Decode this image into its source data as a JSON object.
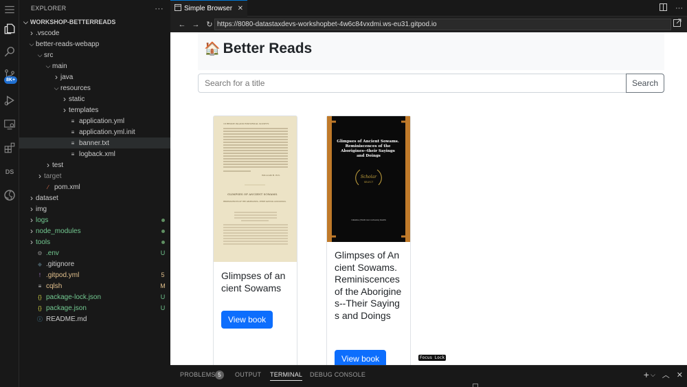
{
  "activity_bar": {
    "items": [
      "menu-icon",
      "explorer-icon",
      "search-icon",
      "source-control-icon",
      "run-debug-icon",
      "remote-explorer-icon",
      "extensions-icon",
      "datastax-icon",
      "github-icon"
    ],
    "source_control_badge": "8K+",
    "ds_label": "DS"
  },
  "sidebar": {
    "title": "EXPLORER",
    "more": "···",
    "root": "WORKSHOP-BETTERREADS",
    "tree": [
      {
        "label": ".vscode",
        "depth": 1,
        "kind": "folder-closed",
        "color": "#cccccc"
      },
      {
        "label": "better-reads-webapp",
        "depth": 1,
        "kind": "folder-open",
        "color": "#cccccc"
      },
      {
        "label": "src",
        "depth": 2,
        "kind": "folder-open",
        "color": "#cccccc"
      },
      {
        "label": "main",
        "depth": 3,
        "kind": "folder-open",
        "color": "#cccccc"
      },
      {
        "label": "java",
        "depth": 4,
        "kind": "folder-closed",
        "color": "#cccccc"
      },
      {
        "label": "resources",
        "depth": 4,
        "kind": "folder-open",
        "color": "#cccccc"
      },
      {
        "label": "static",
        "depth": 5,
        "kind": "folder-closed",
        "color": "#cccccc"
      },
      {
        "label": "templates",
        "depth": 5,
        "kind": "folder-closed",
        "color": "#cccccc"
      },
      {
        "label": "application.yml",
        "depth": 5,
        "kind": "file",
        "icon": "≡",
        "icon_color": "#cccccc",
        "color": "#cccccc"
      },
      {
        "label": "application.yml.init",
        "depth": 5,
        "kind": "file",
        "icon": "≡",
        "icon_color": "#cccccc",
        "color": "#cccccc"
      },
      {
        "label": "banner.txt",
        "depth": 5,
        "kind": "file",
        "icon": "≡",
        "icon_color": "#cccccc",
        "color": "#cccccc",
        "selected": true
      },
      {
        "label": "logback.xml",
        "depth": 5,
        "kind": "file",
        "icon": "≡",
        "icon_color": "#cccccc",
        "color": "#cccccc"
      },
      {
        "label": "test",
        "depth": 3,
        "kind": "folder-closed",
        "color": "#cccccc"
      },
      {
        "label": "target",
        "depth": 2,
        "kind": "folder-closed",
        "color": "#8c8c8c"
      },
      {
        "label": "pom.xml",
        "depth": 2,
        "kind": "file",
        "icon": "⁄",
        "icon_color": "#e2704e",
        "color": "#cccccc"
      },
      {
        "label": "dataset",
        "depth": 1,
        "kind": "folder-closed",
        "color": "#cccccc"
      },
      {
        "label": "img",
        "depth": 1,
        "kind": "folder-closed",
        "color": "#cccccc"
      },
      {
        "label": "logs",
        "depth": 1,
        "kind": "folder-closed",
        "color": "#73c991",
        "decoration": "dot"
      },
      {
        "label": "node_modules",
        "depth": 1,
        "kind": "folder-closed",
        "color": "#73c991",
        "decoration": "dot"
      },
      {
        "label": "tools",
        "depth": 1,
        "kind": "folder-closed",
        "color": "#73c991",
        "decoration": "dot"
      },
      {
        "label": ".env",
        "depth": 1,
        "kind": "file",
        "icon": "⚙",
        "icon_color": "#8c8c8c",
        "color": "#73c991",
        "decoration": "U"
      },
      {
        "label": ".gitignore",
        "depth": 1,
        "kind": "file",
        "icon": "◆",
        "icon_color": "#41535b",
        "color": "#cccccc"
      },
      {
        "label": ".gitpod.yml",
        "depth": 1,
        "kind": "file",
        "icon": "!",
        "icon_color": "#a074c4",
        "color": "#e2c08d",
        "decoration": "5"
      },
      {
        "label": "cqlsh",
        "depth": 1,
        "kind": "file",
        "icon": "≡",
        "icon_color": "#cccccc",
        "color": "#e2c08d",
        "decoration": "M"
      },
      {
        "label": "package-lock.json",
        "depth": 1,
        "kind": "file",
        "icon": "{}",
        "icon_color": "#cbcb41",
        "color": "#73c991",
        "decoration": "U"
      },
      {
        "label": "package.json",
        "depth": 1,
        "kind": "file",
        "icon": "{}",
        "icon_color": "#cbcb41",
        "color": "#73c991",
        "decoration": "U"
      },
      {
        "label": "README.md",
        "depth": 1,
        "kind": "file",
        "icon": "ⓘ",
        "icon_color": "#519aba",
        "color": "#cccccc"
      }
    ]
  },
  "editor": {
    "tab_label": "Simple Browser",
    "tab_close": "✕"
  },
  "browser": {
    "url": "https://8080-datastaxdevs-workshopbet-4w6c84vxdmi.ws-eu31.gitpod.io"
  },
  "page": {
    "house_emoji": "🏠",
    "title": "Better Reads",
    "search_placeholder": "Search for a title",
    "search_button": "Search",
    "books": [
      {
        "title": "Glimpses of ancient Sowams",
        "button": "View book"
      },
      {
        "title": "Glimpses of Ancient Sowams. Reminiscences of the Aborigines--Their Sayings and Doings",
        "button": "View book"
      }
    ],
    "cover1_text": {
      "header": "18          RHODE ISLAND HISTORICAL SOCIETY.",
      "signature": "WILLIAM H. ELY.",
      "heading": "GLIMPSES OF ANCIENT SOWAMS.",
      "subheading": "REMINISCENCES OF THE ABORIGINES—THEIR SAYINGS AND DOINGS."
    },
    "cover2_text": {
      "title": "Glimpses of Ancient Sowams. Reminiscences of the Aborigines--their Sayings and Doings",
      "seal_top": "Scholar",
      "seal_bottom": "SELECT",
      "footer": "VIRGINIA [FROM OLD CATALOG] BAKER"
    },
    "focus_lock": "Focus Lock"
  },
  "panel": {
    "tabs": [
      "PROBLEMS",
      "OUTPUT",
      "TERMINAL",
      "DEBUG CONSOLE"
    ],
    "active_tab": "TERMINAL",
    "problems_count": "5",
    "add": "+",
    "chevron": "⌵",
    "maximize": "︿",
    "close": "✕"
  }
}
